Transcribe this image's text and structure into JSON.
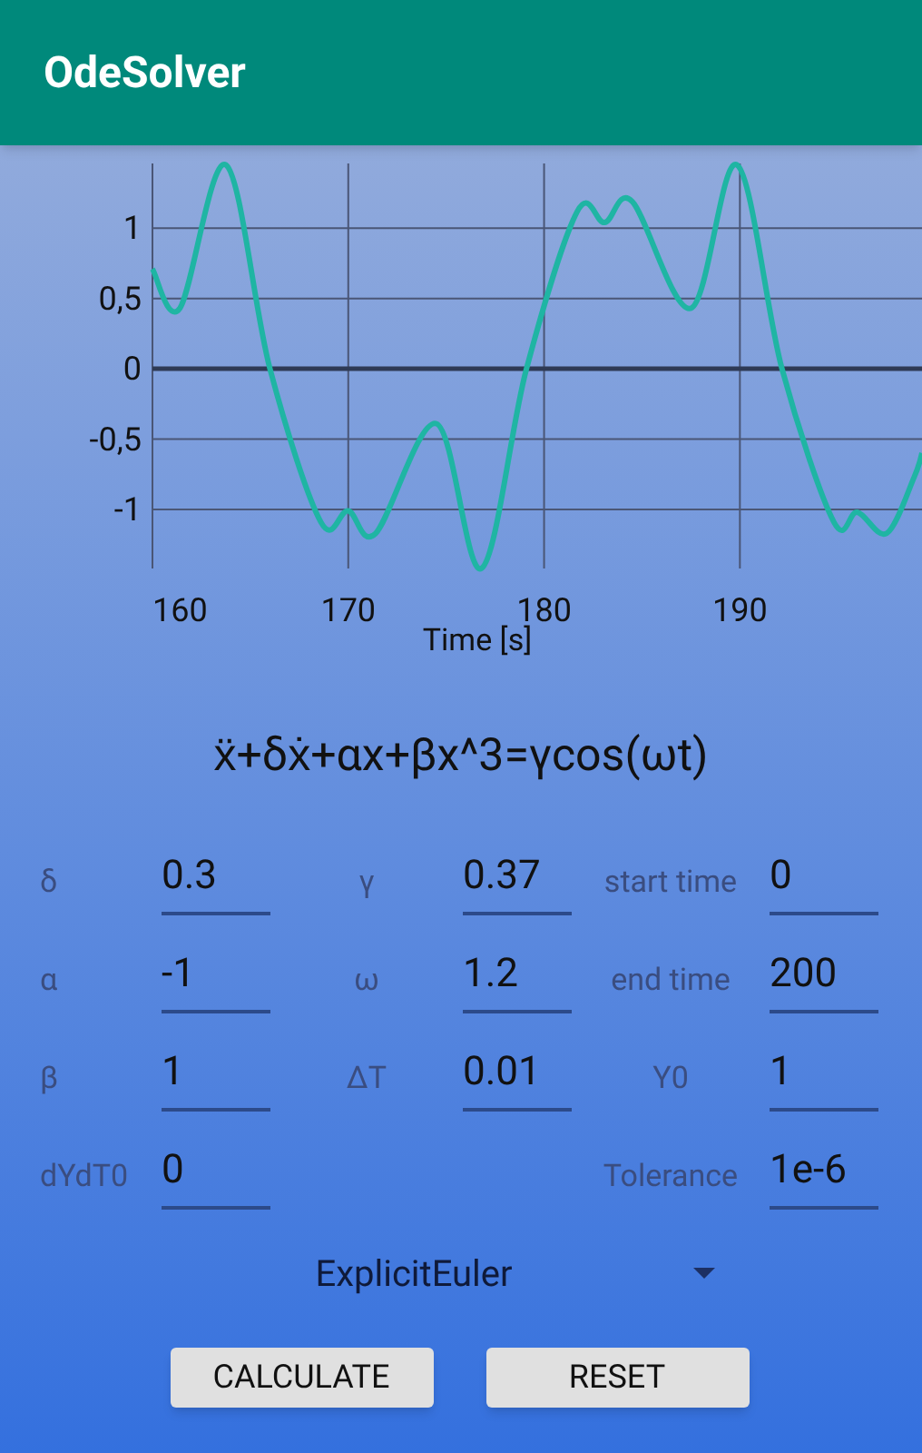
{
  "app_bar": {
    "title": "OdeSolver"
  },
  "chart": {
    "chart_data": {
      "type": "line",
      "xlabel": "Time [s]",
      "x": [
        160,
        161.4,
        163.75,
        166,
        168.6,
        170,
        171.4,
        174.5,
        176.8,
        179.1,
        181.7,
        183.1,
        184.5,
        187.5,
        189.85,
        192.15,
        194.8,
        196,
        197.5,
        198.9,
        199.3
      ],
      "series": [
        {
          "color": "#1fb5a3",
          "values": [
            0.71,
            0.43,
            1.45,
            0,
            -1.09,
            -1.01,
            -1.17,
            -0.39,
            -1.42,
            0,
            1.12,
            1.04,
            1.19,
            0.43,
            1.45,
            0,
            -1.09,
            -1.02,
            -1.17,
            -0.77,
            -0.6
          ]
        }
      ],
      "grid": true,
      "xlim": [
        160,
        199.3
      ],
      "ylim": [
        -1.42,
        1.46
      ],
      "xticks": [
        160,
        170,
        180,
        190
      ],
      "yticks": [
        {
          "value": 1,
          "label": "1"
        },
        {
          "value": 0.5,
          "label": "0,5"
        },
        {
          "value": 0,
          "label": "0"
        },
        {
          "value": -0.5,
          "label": "-0,5"
        },
        {
          "value": -1,
          "label": "-1"
        }
      ]
    }
  },
  "equation": "ẍ+δẋ+αx+βx^3=γcos(ωt)",
  "parameter_columns": [
    {
      "fields": [
        {
          "label": "δ",
          "value": "0.3"
        },
        {
          "label": "α",
          "value": "-1"
        },
        {
          "label": "β",
          "value": "1"
        },
        {
          "label": "dYdT0",
          "value": "0"
        }
      ]
    },
    {
      "fields": [
        {
          "label": "γ",
          "value": "0.37"
        },
        {
          "label": "ω",
          "value": "1.2"
        },
        {
          "label": "ΔT",
          "value": "0.01"
        }
      ]
    },
    {
      "fields": [
        {
          "label": "start time",
          "value": "0"
        },
        {
          "label": "end time",
          "value": "200"
        },
        {
          "label": "Y0",
          "value": "1"
        },
        {
          "label": "Tolerance",
          "value": "1e-6"
        }
      ]
    }
  ],
  "solver_dropdown": {
    "value": "ExplicitEuler"
  },
  "buttons": [
    {
      "label": "CALCULATE"
    },
    {
      "label": "RESET"
    }
  ]
}
